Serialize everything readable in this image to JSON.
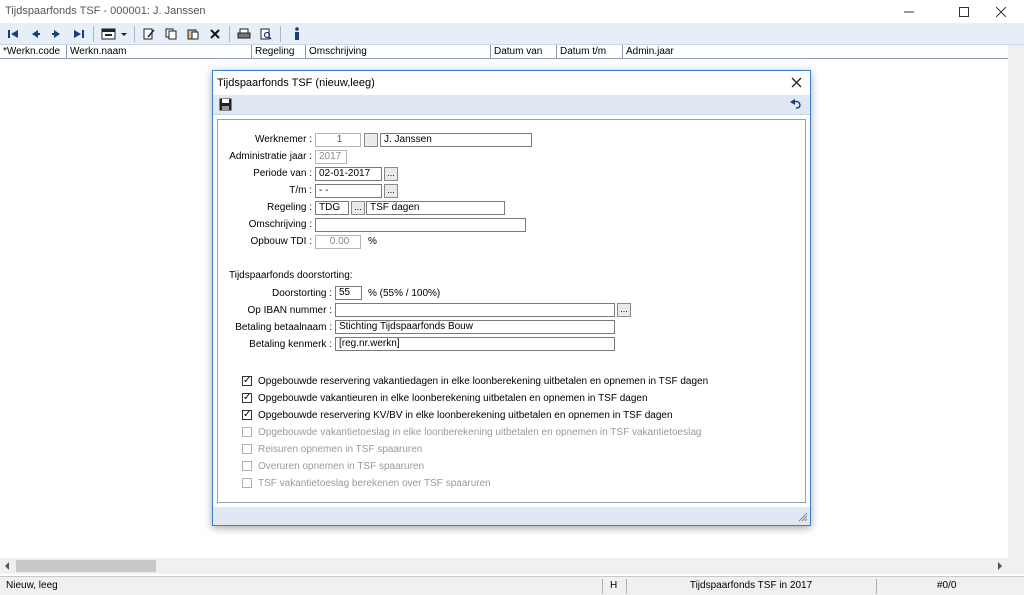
{
  "window": {
    "title": "Tijdspaarfonds TSF - 000001: J. Janssen",
    "minimize_icon": "minimize-icon",
    "maximize_icon": "maximize-icon",
    "close_icon": "close-icon"
  },
  "toolbar": {
    "icons": [
      "first-record-icon",
      "previous-record-icon",
      "next-record-icon",
      "last-record-icon",
      "form-menu-icon",
      "edit-icon",
      "copy-icon",
      "paste-icon",
      "delete-icon",
      "print-icon",
      "print-preview-icon",
      "info-icon"
    ]
  },
  "grid": {
    "columns": [
      "*Werkn.code",
      "Werkn.naam",
      "Regeling",
      "Omschrijving",
      "Datum van",
      "Datum t/m",
      "Admin.jaar"
    ]
  },
  "dialog": {
    "title": "Tijdspaarfonds TSF  (nieuw,leeg)",
    "save_icon": "save-icon",
    "undo_icon": "undo-icon",
    "fields": {
      "werknemer_label": "Werknemer :",
      "werknemer_code": "1",
      "werknemer_naam": "J. Janssen",
      "admin_jaar_label": "Administratie jaar :",
      "admin_jaar": "2017",
      "periode_van_label": "Periode van :",
      "periode_van": "02-01-2017",
      "tm_label": "T/m :",
      "tm": " -  - ",
      "regeling_label": "Regeling :",
      "regeling_code": "TDG",
      "regeling_naam": "TSF dagen",
      "omschrijving_label": "Omschrijving :",
      "omschrijving": "",
      "opbouw_label": "Opbouw TDI :",
      "opbouw": "0.00",
      "opbouw_unit": "%",
      "section_title": "Tijdspaarfonds doorstorting:",
      "doorstorting_label": "Doorstorting :",
      "doorstorting": "55",
      "doorstorting_note": "%  (55% / 100%)",
      "iban_label": "Op IBAN nummer :",
      "iban": "",
      "betaalnaam_label": "Betaling betaalnaam :",
      "betaalnaam": "Stichting Tijdspaarfonds Bouw",
      "kenmerk_label": "Betaling kenmerk :",
      "kenmerk": "[reg.nr.werkn]",
      "lookup_button": "..."
    },
    "checkboxes": [
      {
        "label": "Opgebouwde reservering vakantiedagen in elke loonberekening uitbetalen en opnemen in TSF dagen",
        "checked": true,
        "enabled": true
      },
      {
        "label": "Opgebouwde vakantieuren in elke loonberekening uitbetalen en opnemen in TSF dagen",
        "checked": true,
        "enabled": true
      },
      {
        "label": "Opgebouwde reservering KV/BV in elke loonberekening uitbetalen en opnemen in TSF dagen",
        "checked": true,
        "enabled": true
      },
      {
        "label": "Opgebouwde vakantietoeslag in elke loonberekening uitbetalen en opnemen in TSF vakantietoeslag",
        "checked": false,
        "enabled": false
      },
      {
        "label": "Reisuren opnemen in TSF spaaruren",
        "checked": false,
        "enabled": false
      },
      {
        "label": "Overuren opnemen in TSF spaaruren",
        "checked": false,
        "enabled": false
      },
      {
        "label": "TSF vakantietoeslag berekenen over TSF spaaruren",
        "checked": false,
        "enabled": false
      }
    ]
  },
  "statusbar": {
    "mode": "Nieuw, leeg",
    "flag": "H",
    "context": "Tijdspaarfonds TSF in 2017",
    "record": "#0/0"
  }
}
